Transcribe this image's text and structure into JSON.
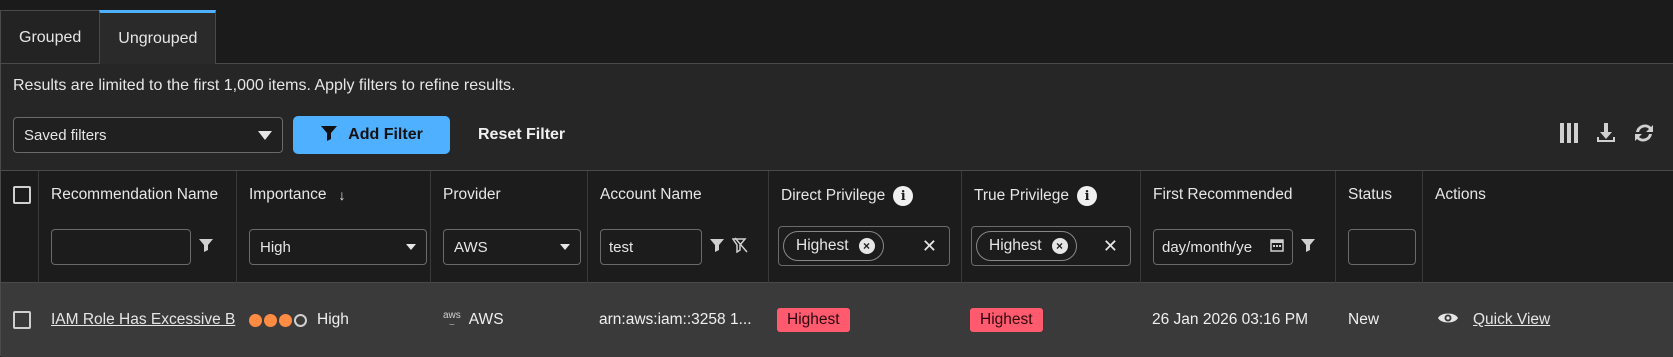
{
  "tabs": [
    {
      "label": "Grouped",
      "active": false
    },
    {
      "label": "Ungrouped",
      "active": true
    }
  ],
  "notice": "Results are limited to the first 1,000 items. Apply filters to refine results.",
  "toolbar": {
    "saved_filters": "Saved filters",
    "add_filter": "Add Filter",
    "reset_filter": "Reset Filter",
    "icons": [
      "columns-icon",
      "download-icon",
      "refresh-icon"
    ]
  },
  "columns": {
    "recommendation_name": {
      "title": "Recommendation Name",
      "filter_value": ""
    },
    "importance": {
      "title": "Importance",
      "sort": "↓",
      "filter_value": "High"
    },
    "provider": {
      "title": "Provider",
      "filter_value": "AWS"
    },
    "account_name": {
      "title": "Account Name",
      "filter_value": "test"
    },
    "direct_privilege": {
      "title": "Direct Privilege",
      "chip": "Highest"
    },
    "true_privilege": {
      "title": "True Privilege",
      "chip": "Highest"
    },
    "first_recommended": {
      "title": "First Recommended",
      "placeholder": "day/month/ye"
    },
    "status": {
      "title": "Status",
      "filter_value": ""
    },
    "actions": {
      "title": "Actions"
    }
  },
  "rows": [
    {
      "recommendation_name": "IAM Role Has Excessive B",
      "importance": "High",
      "importance_level": 3,
      "importance_max": 4,
      "provider_logo": "aws",
      "provider": "AWS",
      "account_name": "arn:aws:iam::3258 1...",
      "direct_privilege": "Highest",
      "true_privilege": "Highest",
      "first_recommended": "26 Jan 2026 03:16 PM",
      "status": "New",
      "action": "Quick View"
    }
  ],
  "colors": {
    "accent": "#4fb0ff",
    "importance": "#ff8c42",
    "badge": "#ff5a6e"
  }
}
